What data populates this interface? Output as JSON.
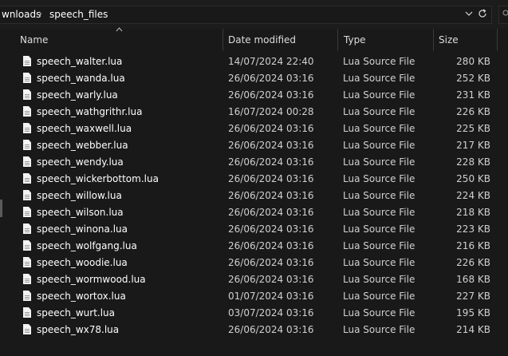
{
  "address": {
    "crumbs": [
      "wnloads",
      "speech_files"
    ],
    "separator": "›",
    "dropdown_icon": "chevron-down-icon",
    "refresh_icon": "refresh-icon"
  },
  "columns": {
    "name": "Name",
    "date": "Date modified",
    "type": "Type",
    "size": "Size"
  },
  "files": [
    {
      "name": "speech_walter.lua",
      "date": "14/07/2024 22:40",
      "type": "Lua Source File",
      "size": "280 KB"
    },
    {
      "name": "speech_wanda.lua",
      "date": "26/06/2024 03:16",
      "type": "Lua Source File",
      "size": "252 KB"
    },
    {
      "name": "speech_warly.lua",
      "date": "26/06/2024 03:16",
      "type": "Lua Source File",
      "size": "231 KB"
    },
    {
      "name": "speech_wathgrithr.lua",
      "date": "16/07/2024 00:28",
      "type": "Lua Source File",
      "size": "226 KB"
    },
    {
      "name": "speech_waxwell.lua",
      "date": "26/06/2024 03:16",
      "type": "Lua Source File",
      "size": "225 KB"
    },
    {
      "name": "speech_webber.lua",
      "date": "26/06/2024 03:16",
      "type": "Lua Source File",
      "size": "217 KB"
    },
    {
      "name": "speech_wendy.lua",
      "date": "26/06/2024 03:16",
      "type": "Lua Source File",
      "size": "228 KB"
    },
    {
      "name": "speech_wickerbottom.lua",
      "date": "26/06/2024 03:16",
      "type": "Lua Source File",
      "size": "250 KB"
    },
    {
      "name": "speech_willow.lua",
      "date": "26/06/2024 03:16",
      "type": "Lua Source File",
      "size": "224 KB"
    },
    {
      "name": "speech_wilson.lua",
      "date": "26/06/2024 03:16",
      "type": "Lua Source File",
      "size": "218 KB"
    },
    {
      "name": "speech_winona.lua",
      "date": "26/06/2024 03:16",
      "type": "Lua Source File",
      "size": "223 KB"
    },
    {
      "name": "speech_wolfgang.lua",
      "date": "26/06/2024 03:16",
      "type": "Lua Source File",
      "size": "216 KB"
    },
    {
      "name": "speech_woodie.lua",
      "date": "26/06/2024 03:16",
      "type": "Lua Source File",
      "size": "226 KB"
    },
    {
      "name": "speech_wormwood.lua",
      "date": "26/06/2024 03:16",
      "type": "Lua Source File",
      "size": "168 KB"
    },
    {
      "name": "speech_wortox.lua",
      "date": "01/07/2024 03:16",
      "type": "Lua Source File",
      "size": "227 KB"
    },
    {
      "name": "speech_wurt.lua",
      "date": "03/07/2024 03:16",
      "type": "Lua Source File",
      "size": "195 KB"
    },
    {
      "name": "speech_wx78.lua",
      "date": "26/06/2024 03:16",
      "type": "Lua Source File",
      "size": "214 KB"
    }
  ]
}
